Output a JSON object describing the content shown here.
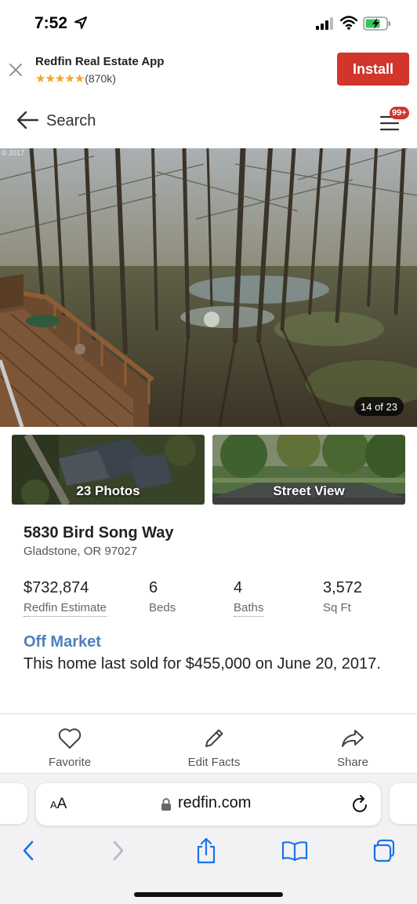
{
  "status_bar": {
    "time": "7:52"
  },
  "banner": {
    "title": "Redfin Real Estate App",
    "stars": "★★★★★",
    "rating_count": "(870k)",
    "install_label": "Install",
    "accent": "#d1352c"
  },
  "header": {
    "back_label": "Search",
    "menu_badge": "99+"
  },
  "gallery": {
    "copyright": "© 2017",
    "counter": "14 of 23",
    "photos_label": "23 Photos",
    "street_view_label": "Street View"
  },
  "listing": {
    "address": "5830 Bird Song Way",
    "city": "Gladstone, OR 97027",
    "stats": [
      {
        "value": "$732,874",
        "label": "Redfin Estimate"
      },
      {
        "value": "6",
        "label": "Beds"
      },
      {
        "value": "4",
        "label": "Baths"
      },
      {
        "value": "3,572",
        "label": "Sq Ft"
      }
    ],
    "status": "Off Market",
    "status_color": "#4e7fbb",
    "sold_text": "This home last sold for $455,000 on June 20, 2017."
  },
  "actions": [
    {
      "label": "Favorite",
      "icon": "heart-icon"
    },
    {
      "label": "Edit Facts",
      "icon": "pencil-icon"
    },
    {
      "label": "Share",
      "icon": "share-arrow-icon"
    }
  ],
  "browser": {
    "aa_label": "AA",
    "url": "redfin.com"
  }
}
